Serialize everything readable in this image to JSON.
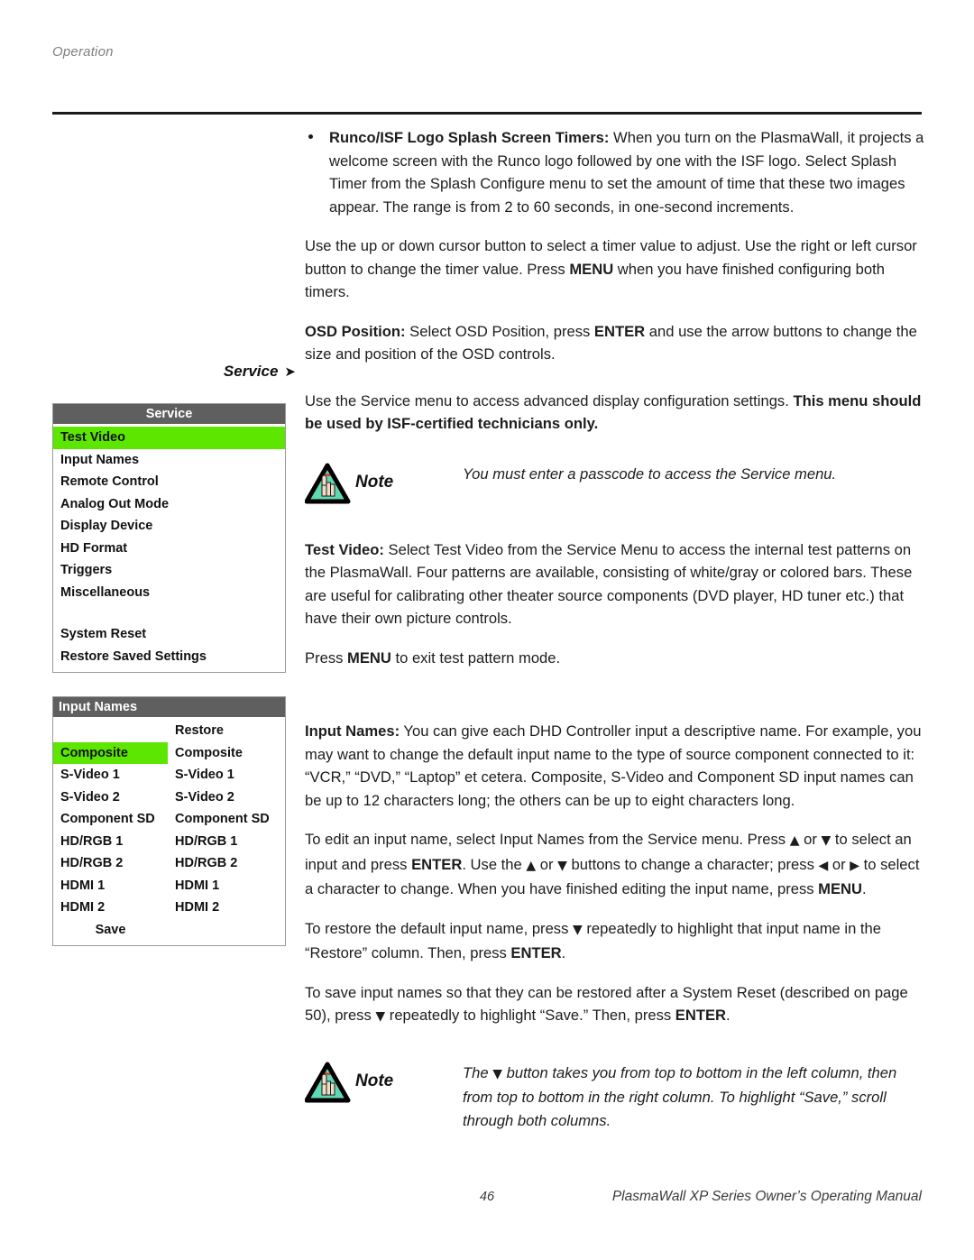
{
  "header": {
    "running_head": "Operation"
  },
  "body": {
    "bullet1_title": "Runco/ISF Logo Splash Screen Timers:",
    "bullet1_text": " When you turn on the PlasmaWall, it projects a welcome screen with the Runco logo followed by one with the ISF logo. Select Splash Timer from the Splash Configure menu to set the amount of time that these two images appear. The range is from 2 to 60 seconds, in one-second increments.",
    "para_cursor_a": "Use the up or down cursor button to select a timer value to adjust. Use the right or left cursor button to change the timer value. Press ",
    "para_cursor_menu": "MENU",
    "para_cursor_b": " when you have finished configuring both timers.",
    "osd_title": "OSD Position:",
    "osd_text_a": " Select OSD Position, press ",
    "osd_enter": "ENTER",
    "osd_text_b": " and use the arrow buttons to change the size and position of the OSD controls.",
    "service_intro_a": "Use the Service menu to access advanced display configuration settings. ",
    "service_intro_bold": "This menu should be used by ISF-certified technicians only.",
    "note1_label": "Note",
    "note1_text": "You must enter a passcode to access the Service menu.",
    "testvideo_title": "Test Video:",
    "testvideo_text": " Select Test Video from the Service Menu to access the internal test patterns on the PlasmaWall. Four patterns are available, consisting of white/gray or colored bars. These are useful for calibrating other theater source components (DVD player, HD tuner etc.) that have their own picture controls.",
    "press_menu_a": "Press ",
    "press_menu_bold": "MENU",
    "press_menu_b": " to exit test pattern mode.",
    "inputnames_title": "Input Names:",
    "inputnames_text": " You can give each DHD Controller input a descriptive name. For example, you may want to change the default input name to the type of source component connected to it: “VCR,” “DVD,” “Laptop” et cetera. Composite, S-Video and Component SD input names can be up to 12 characters long; the others can be up to eight characters long.",
    "edit_a": "To edit an input name, select Input Names from the Service menu. Press ",
    "edit_up1": "▲",
    "edit_b": " or ",
    "edit_down1": "▼",
    "edit_c": " to select an input and press ",
    "edit_enter": "ENTER",
    "edit_d": ". Use the ",
    "edit_up2": "▲",
    "edit_e": " or ",
    "edit_down2": "▼",
    "edit_f": " buttons to change a character; press ",
    "edit_left": "◀",
    "edit_g": " or ",
    "edit_right": "▶",
    "edit_h": " to select a character to change. When you have finished editing the input name, press ",
    "edit_menu": "MENU",
    "edit_i": ".",
    "restore_a": "To restore the default input name, press ",
    "restore_down": "▼",
    "restore_b": " repeatedly to highlight that input name in the “Restore” column. Then, press ",
    "restore_enter": "ENTER",
    "restore_c": ".",
    "save_a": "To save input names so that they can be restored after a System Reset (described on page 50), press ",
    "save_down": "▼",
    "save_b": " repeatedly to highlight “Save.” Then, press ",
    "save_enter": "ENTER",
    "save_c": ".",
    "note2_label": "Note",
    "note2_a": "The ",
    "note2_down": "▼",
    "note2_b": " button takes you from top to bottom in the left column, then from top to bottom in the right column. To highlight “Save,” scroll through both columns."
  },
  "margin_labels": {
    "service": "Service",
    "service_marker": "➤"
  },
  "service_menu": {
    "title": "Service",
    "highlight_color": "#5ce600",
    "header_color": "#5f5f5f",
    "items": [
      {
        "label": "Test Video",
        "highlighted": true
      },
      {
        "label": "Input Names",
        "highlighted": false
      },
      {
        "label": "Remote Control",
        "highlighted": false
      },
      {
        "label": "Analog Out Mode",
        "highlighted": false
      },
      {
        "label": "Display Device",
        "highlighted": false
      },
      {
        "label": "HD Format",
        "highlighted": false
      },
      {
        "label": "Triggers",
        "highlighted": false
      },
      {
        "label": "Miscellaneous",
        "highlighted": false
      },
      {
        "label": "",
        "highlighted": false
      },
      {
        "label": "System Reset",
        "highlighted": false
      },
      {
        "label": "Restore Saved Settings",
        "highlighted": false
      }
    ]
  },
  "input_names_menu": {
    "title": "Input Names",
    "restore_header": "Restore",
    "rows": [
      {
        "left": "",
        "right": "Restore",
        "highlighted": false,
        "right_is_header": true
      },
      {
        "left": "Composite",
        "right": "Composite",
        "highlighted": true
      },
      {
        "left": "S-Video 1",
        "right": "S-Video 1",
        "highlighted": false
      },
      {
        "left": "S-Video 2",
        "right": "S-Video 2",
        "highlighted": false
      },
      {
        "left": "Component SD",
        "right": "Component SD",
        "highlighted": false
      },
      {
        "left": "HD/RGB 1",
        "right": "HD/RGB 1",
        "highlighted": false
      },
      {
        "left": "HD/RGB 2",
        "right": "HD/RGB 2",
        "highlighted": false
      },
      {
        "left": "HDMI 1",
        "right": "HDMI 1",
        "highlighted": false
      },
      {
        "left": "HDMI 2",
        "right": "HDMI 2",
        "highlighted": false
      }
    ],
    "save_label": "Save"
  },
  "footer": {
    "page_number": "46",
    "manual_title": "PlasmaWall XP Series Owner’s Operating Manual"
  },
  "icons": {
    "note_triangle_fill": "#5fd8b4",
    "note_hand_fill": "#f2dfc8",
    "note_ribbon": "#e03020"
  }
}
